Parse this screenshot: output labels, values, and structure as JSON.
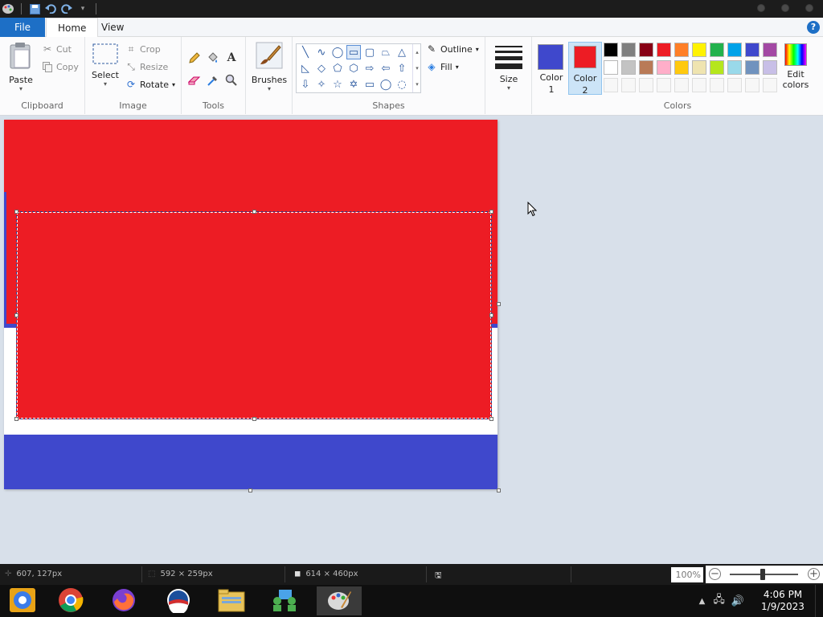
{
  "tabs": {
    "file": "File",
    "home": "Home",
    "view": "View"
  },
  "help_label": "?",
  "ribbon": {
    "clipboard": {
      "label": "Clipboard",
      "paste": "Paste",
      "cut": "Cut",
      "copy": "Copy"
    },
    "image": {
      "label": "Image",
      "select": "Select",
      "crop": "Crop",
      "resize": "Resize",
      "rotate": "Rotate"
    },
    "tools": {
      "label": "Tools"
    },
    "brushes": {
      "label": "Brushes"
    },
    "shapes": {
      "label": "Shapes",
      "outline": "Outline",
      "fill": "Fill"
    },
    "size": {
      "label": "Size"
    },
    "colors": {
      "label": "Colors",
      "color1": "Color",
      "color1_num": "1",
      "color2": "Color",
      "color2_num": "2",
      "edit": "Edit",
      "edit2": "colors",
      "color1_value": "#3f48cc",
      "color2_value": "#ed1c24",
      "palette_row1": [
        "#000000",
        "#7f7f7f",
        "#880015",
        "#ed1c24",
        "#ff7f27",
        "#fff200",
        "#22b14c",
        "#00a2e8",
        "#3f48cc",
        "#a349a4"
      ],
      "palette_row2": [
        "#ffffff",
        "#c3c3c3",
        "#b97a57",
        "#ffaec9",
        "#ffc90e",
        "#efe4b0",
        "#b5e61d",
        "#99d9ea",
        "#7092be",
        "#c8bfe7"
      ]
    }
  },
  "canvas_colors": {
    "red": "#ed1c24",
    "blue": "#3f48cc",
    "white": "#ffffff"
  },
  "status": {
    "cursor_pos": "607, 127px",
    "selection_size": "592 × 259px",
    "image_size": "614 × 460px",
    "zoom": "100%"
  },
  "taskbar": {
    "apps": [
      "chromium-icon",
      "chrome-icon",
      "firefox-icon",
      "obama-logo-icon",
      "file-explorer-icon",
      "network-people-icon",
      "paint-icon"
    ],
    "time": "4:06 PM",
    "date": "1/9/2023"
  }
}
